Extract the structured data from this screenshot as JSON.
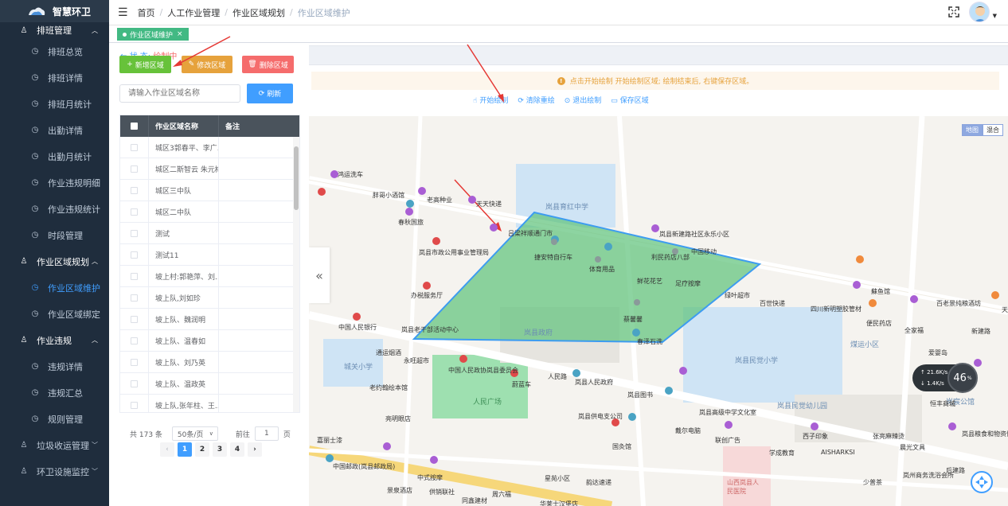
{
  "app": {
    "title": "智慧环卫"
  },
  "sidebar": {
    "items": [
      {
        "label": "排班管理",
        "type": "group",
        "open": true
      },
      {
        "label": "排班总览",
        "type": "sub"
      },
      {
        "label": "排班详情",
        "type": "sub"
      },
      {
        "label": "排班月统计",
        "type": "sub"
      },
      {
        "label": "出勤详情",
        "type": "sub"
      },
      {
        "label": "出勤月统计",
        "type": "sub"
      },
      {
        "label": "作业违规明细",
        "type": "sub"
      },
      {
        "label": "作业违规统计",
        "type": "sub"
      },
      {
        "label": "时段管理",
        "type": "sub"
      },
      {
        "label": "作业区域规划",
        "type": "group",
        "open": true
      },
      {
        "label": "作业区域维护",
        "type": "sub",
        "active": true
      },
      {
        "label": "作业区域绑定",
        "type": "sub"
      },
      {
        "label": "作业违规",
        "type": "group",
        "open": true
      },
      {
        "label": "违规详情",
        "type": "sub"
      },
      {
        "label": "违规汇总",
        "type": "sub"
      },
      {
        "label": "规则管理",
        "type": "sub"
      },
      {
        "label": "垃圾收运管理",
        "type": "group"
      },
      {
        "label": "环卫设施监控",
        "type": "group"
      }
    ]
  },
  "breadcrumb": [
    "首页",
    "人工作业管理",
    "作业区域规划",
    "作业区域维护"
  ],
  "tags": {
    "active": "作业区域维护"
  },
  "panel": {
    "status_label": "状 态:",
    "status_value": "绘制中",
    "add_label": "新增区域",
    "edit_label": "修改区域",
    "delete_label": "删除区域",
    "search_placeholder": "请输入作业区域名称",
    "refresh_label": "刷新",
    "table": {
      "headers": [
        "作业区域名称",
        "备注"
      ],
      "rows": [
        "城区3郭春平、李广...",
        "城区二斯智云 朱元梅",
        "城区三中队",
        "城区二中队",
        "测试",
        "测试11",
        "坡上村:郭艳萍、刘...",
        "坡上队,刘如珍",
        "坡上队、魏润明",
        "坡上队、温春如",
        "坡上队、刘乃英",
        "坡上队、温政英",
        "坡上队,张年柱、王..."
      ]
    },
    "pager": {
      "total": "共 173 条",
      "page_size": "50条/页",
      "goto_label": "前往",
      "goto_value": "1",
      "page_suffix": "页",
      "pages": [
        "1",
        "2",
        "3",
        "4"
      ]
    }
  },
  "map_panel": {
    "notice": "点击开始绘制 开始绘制区域; 绘制结束后, 右键保存区域。",
    "actions": [
      "开始绘制",
      "清除重绘",
      "退出绘制",
      "保存区域"
    ],
    "map_types": [
      "地图",
      "混合"
    ],
    "speed": {
      "up": "21.6K/s",
      "down": "1.4K/s",
      "percent": "46",
      "unit": "%"
    },
    "labels": [
      "鸿运洗车",
      "胖哥小酒馆",
      "老高种业",
      "天天快递",
      "岚县育红中学",
      "春秋国旅",
      "吕梁祥顺通门市",
      "岚县市政公用事业管理局",
      "捷安特自行车",
      "体育用品",
      "岚县新建路社区永乐小区",
      "中国移动",
      "利民药店八部",
      "鲜花花艺",
      "足疗按摩",
      "绿叶超市",
      "办税服务厅",
      "中国人民银行",
      "岚县老干部活动中心",
      "岚县政府",
      "蔡馨馨",
      "春泽石洗",
      "百世快递",
      "四川新明塑胶管材",
      "便民药店",
      "全家福",
      "煤运小区",
      "岚县民觉小学",
      "城关小学",
      "通运烟酒",
      "永旺超市",
      "中国人民政协岚县委员会",
      "人民广场",
      "人民路",
      "岚县人民政府",
      "岚县图书",
      "蔚蓝车",
      "老约翰绘本馆",
      "亮明眼店",
      "岚县供电支公司",
      "岚县高级中学文化室",
      "岚县民觉幼儿园",
      "新建路",
      "爱婴岛",
      "岚宸公馆",
      "中国邮政(岚县邮政局)",
      "嘉丽士漆",
      "国灸馆",
      "联创广告",
      "学成教育",
      "西子印象",
      "AISHARKSI",
      "张亮麻辣烫",
      "晨光文具",
      "中式按摩",
      "星苑小区",
      "韵达速递",
      "山西岚县人民医院",
      "少普茶",
      "岚州商务洗浴会所",
      "后建路",
      "供销联社",
      "同鑫建材",
      "华莱士汉堡店",
      "周六福",
      "景泉酒店",
      "天正电器",
      "恒丰商城",
      "岚县粮食和物资储备局住宅小区",
      "百老景纯粮酒坊",
      "蘇鱼馆",
      "戴尔电脑"
    ]
  }
}
